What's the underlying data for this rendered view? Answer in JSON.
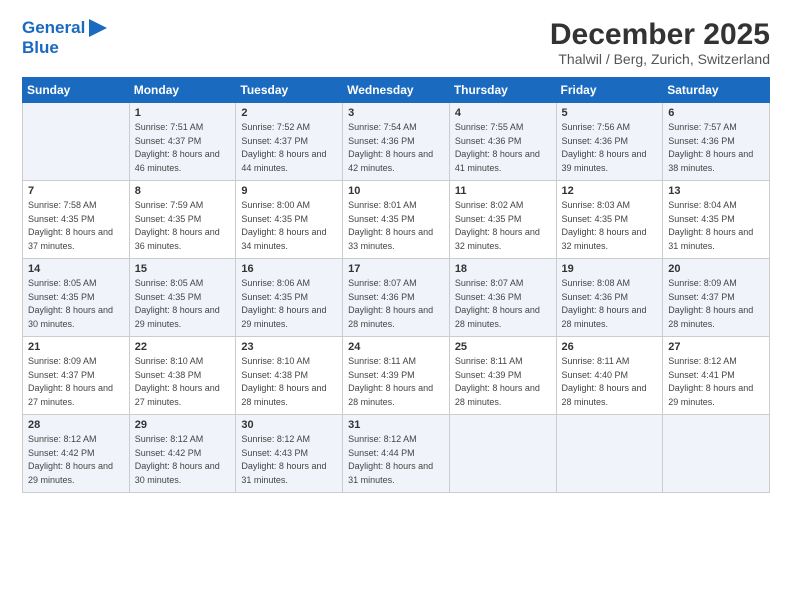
{
  "logo": {
    "line1": "General",
    "line2": "Blue",
    "icon": "▶"
  },
  "title": "December 2025",
  "location": "Thalwil / Berg, Zurich, Switzerland",
  "days_of_week": [
    "Sunday",
    "Monday",
    "Tuesday",
    "Wednesday",
    "Thursday",
    "Friday",
    "Saturday"
  ],
  "weeks": [
    [
      {
        "day": "",
        "sunrise": "",
        "sunset": "",
        "daylight": ""
      },
      {
        "day": "1",
        "sunrise": "Sunrise: 7:51 AM",
        "sunset": "Sunset: 4:37 PM",
        "daylight": "Daylight: 8 hours and 46 minutes."
      },
      {
        "day": "2",
        "sunrise": "Sunrise: 7:52 AM",
        "sunset": "Sunset: 4:37 PM",
        "daylight": "Daylight: 8 hours and 44 minutes."
      },
      {
        "day": "3",
        "sunrise": "Sunrise: 7:54 AM",
        "sunset": "Sunset: 4:36 PM",
        "daylight": "Daylight: 8 hours and 42 minutes."
      },
      {
        "day": "4",
        "sunrise": "Sunrise: 7:55 AM",
        "sunset": "Sunset: 4:36 PM",
        "daylight": "Daylight: 8 hours and 41 minutes."
      },
      {
        "day": "5",
        "sunrise": "Sunrise: 7:56 AM",
        "sunset": "Sunset: 4:36 PM",
        "daylight": "Daylight: 8 hours and 39 minutes."
      },
      {
        "day": "6",
        "sunrise": "Sunrise: 7:57 AM",
        "sunset": "Sunset: 4:36 PM",
        "daylight": "Daylight: 8 hours and 38 minutes."
      }
    ],
    [
      {
        "day": "7",
        "sunrise": "Sunrise: 7:58 AM",
        "sunset": "Sunset: 4:35 PM",
        "daylight": "Daylight: 8 hours and 37 minutes."
      },
      {
        "day": "8",
        "sunrise": "Sunrise: 7:59 AM",
        "sunset": "Sunset: 4:35 PM",
        "daylight": "Daylight: 8 hours and 36 minutes."
      },
      {
        "day": "9",
        "sunrise": "Sunrise: 8:00 AM",
        "sunset": "Sunset: 4:35 PM",
        "daylight": "Daylight: 8 hours and 34 minutes."
      },
      {
        "day": "10",
        "sunrise": "Sunrise: 8:01 AM",
        "sunset": "Sunset: 4:35 PM",
        "daylight": "Daylight: 8 hours and 33 minutes."
      },
      {
        "day": "11",
        "sunrise": "Sunrise: 8:02 AM",
        "sunset": "Sunset: 4:35 PM",
        "daylight": "Daylight: 8 hours and 32 minutes."
      },
      {
        "day": "12",
        "sunrise": "Sunrise: 8:03 AM",
        "sunset": "Sunset: 4:35 PM",
        "daylight": "Daylight: 8 hours and 32 minutes."
      },
      {
        "day": "13",
        "sunrise": "Sunrise: 8:04 AM",
        "sunset": "Sunset: 4:35 PM",
        "daylight": "Daylight: 8 hours and 31 minutes."
      }
    ],
    [
      {
        "day": "14",
        "sunrise": "Sunrise: 8:05 AM",
        "sunset": "Sunset: 4:35 PM",
        "daylight": "Daylight: 8 hours and 30 minutes."
      },
      {
        "day": "15",
        "sunrise": "Sunrise: 8:05 AM",
        "sunset": "Sunset: 4:35 PM",
        "daylight": "Daylight: 8 hours and 29 minutes."
      },
      {
        "day": "16",
        "sunrise": "Sunrise: 8:06 AM",
        "sunset": "Sunset: 4:35 PM",
        "daylight": "Daylight: 8 hours and 29 minutes."
      },
      {
        "day": "17",
        "sunrise": "Sunrise: 8:07 AM",
        "sunset": "Sunset: 4:36 PM",
        "daylight": "Daylight: 8 hours and 28 minutes."
      },
      {
        "day": "18",
        "sunrise": "Sunrise: 8:07 AM",
        "sunset": "Sunset: 4:36 PM",
        "daylight": "Daylight: 8 hours and 28 minutes."
      },
      {
        "day": "19",
        "sunrise": "Sunrise: 8:08 AM",
        "sunset": "Sunset: 4:36 PM",
        "daylight": "Daylight: 8 hours and 28 minutes."
      },
      {
        "day": "20",
        "sunrise": "Sunrise: 8:09 AM",
        "sunset": "Sunset: 4:37 PM",
        "daylight": "Daylight: 8 hours and 28 minutes."
      }
    ],
    [
      {
        "day": "21",
        "sunrise": "Sunrise: 8:09 AM",
        "sunset": "Sunset: 4:37 PM",
        "daylight": "Daylight: 8 hours and 27 minutes."
      },
      {
        "day": "22",
        "sunrise": "Sunrise: 8:10 AM",
        "sunset": "Sunset: 4:38 PM",
        "daylight": "Daylight: 8 hours and 27 minutes."
      },
      {
        "day": "23",
        "sunrise": "Sunrise: 8:10 AM",
        "sunset": "Sunset: 4:38 PM",
        "daylight": "Daylight: 8 hours and 28 minutes."
      },
      {
        "day": "24",
        "sunrise": "Sunrise: 8:11 AM",
        "sunset": "Sunset: 4:39 PM",
        "daylight": "Daylight: 8 hours and 28 minutes."
      },
      {
        "day": "25",
        "sunrise": "Sunrise: 8:11 AM",
        "sunset": "Sunset: 4:39 PM",
        "daylight": "Daylight: 8 hours and 28 minutes."
      },
      {
        "day": "26",
        "sunrise": "Sunrise: 8:11 AM",
        "sunset": "Sunset: 4:40 PM",
        "daylight": "Daylight: 8 hours and 28 minutes."
      },
      {
        "day": "27",
        "sunrise": "Sunrise: 8:12 AM",
        "sunset": "Sunset: 4:41 PM",
        "daylight": "Daylight: 8 hours and 29 minutes."
      }
    ],
    [
      {
        "day": "28",
        "sunrise": "Sunrise: 8:12 AM",
        "sunset": "Sunset: 4:42 PM",
        "daylight": "Daylight: 8 hours and 29 minutes."
      },
      {
        "day": "29",
        "sunrise": "Sunrise: 8:12 AM",
        "sunset": "Sunset: 4:42 PM",
        "daylight": "Daylight: 8 hours and 30 minutes."
      },
      {
        "day": "30",
        "sunrise": "Sunrise: 8:12 AM",
        "sunset": "Sunset: 4:43 PM",
        "daylight": "Daylight: 8 hours and 31 minutes."
      },
      {
        "day": "31",
        "sunrise": "Sunrise: 8:12 AM",
        "sunset": "Sunset: 4:44 PM",
        "daylight": "Daylight: 8 hours and 31 minutes."
      },
      {
        "day": "",
        "sunrise": "",
        "sunset": "",
        "daylight": ""
      },
      {
        "day": "",
        "sunrise": "",
        "sunset": "",
        "daylight": ""
      },
      {
        "day": "",
        "sunrise": "",
        "sunset": "",
        "daylight": ""
      }
    ]
  ]
}
